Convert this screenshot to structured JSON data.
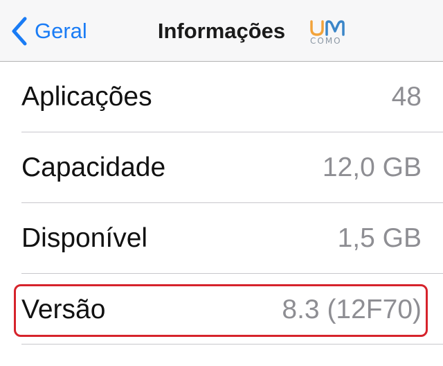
{
  "navbar": {
    "back_label": "Geral",
    "title": "Informações",
    "logo_text": "COMO",
    "accent_color": "#1a7cf5",
    "back_icon": "chevron-left-icon"
  },
  "rows": [
    {
      "label": "Aplicações",
      "value": "48"
    },
    {
      "label": "Capacidade",
      "value": "12,0 GB"
    },
    {
      "label": "Disponível",
      "value": "1,5 GB"
    },
    {
      "label": "Versão",
      "value": "8.3 (12F70)"
    }
  ],
  "highlight_color": "#d6232b"
}
